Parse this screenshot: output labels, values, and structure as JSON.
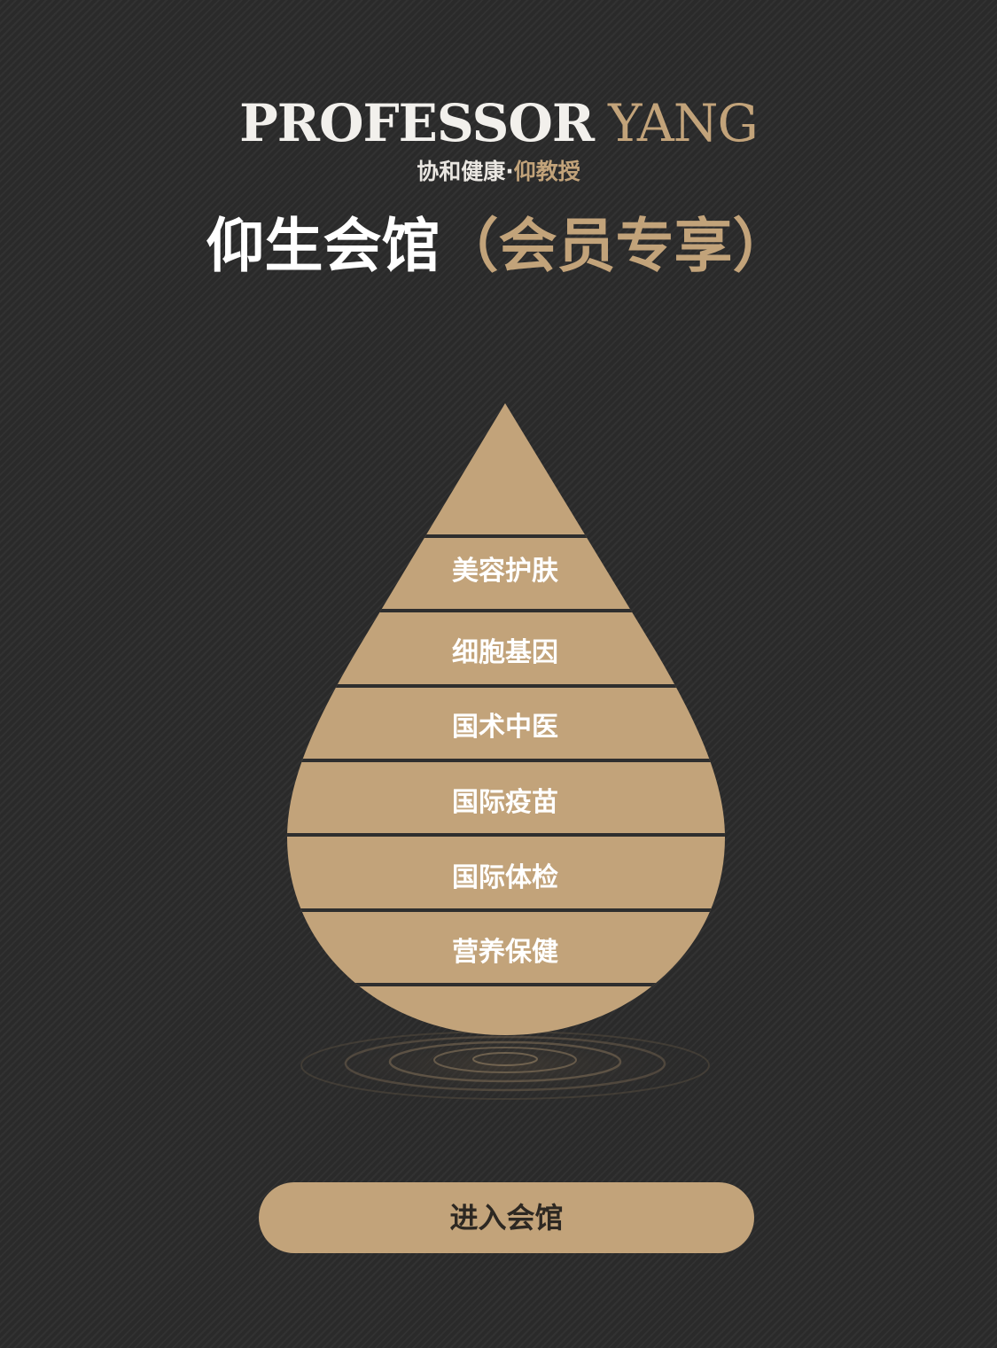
{
  "brand": {
    "logo_white": "PROFESSOR",
    "logo_gold": "YANG",
    "tagline_white": "协和健康·",
    "tagline_gold": "仰教授"
  },
  "header": {
    "title_white": "仰生会馆",
    "title_gold": "（会员专享）"
  },
  "drop": {
    "items": [
      {
        "label": "美容护肤"
      },
      {
        "label": "细胞基因"
      },
      {
        "label": "国术中医"
      },
      {
        "label": "国际疫苗"
      },
      {
        "label": "国际体检"
      },
      {
        "label": "营养保健"
      }
    ]
  },
  "cta": {
    "label": "进入会馆"
  },
  "colors": {
    "background": "#2a2a2a",
    "gold": "#c2a37a",
    "white": "#ffffff",
    "divider": "#2e2e2e"
  }
}
